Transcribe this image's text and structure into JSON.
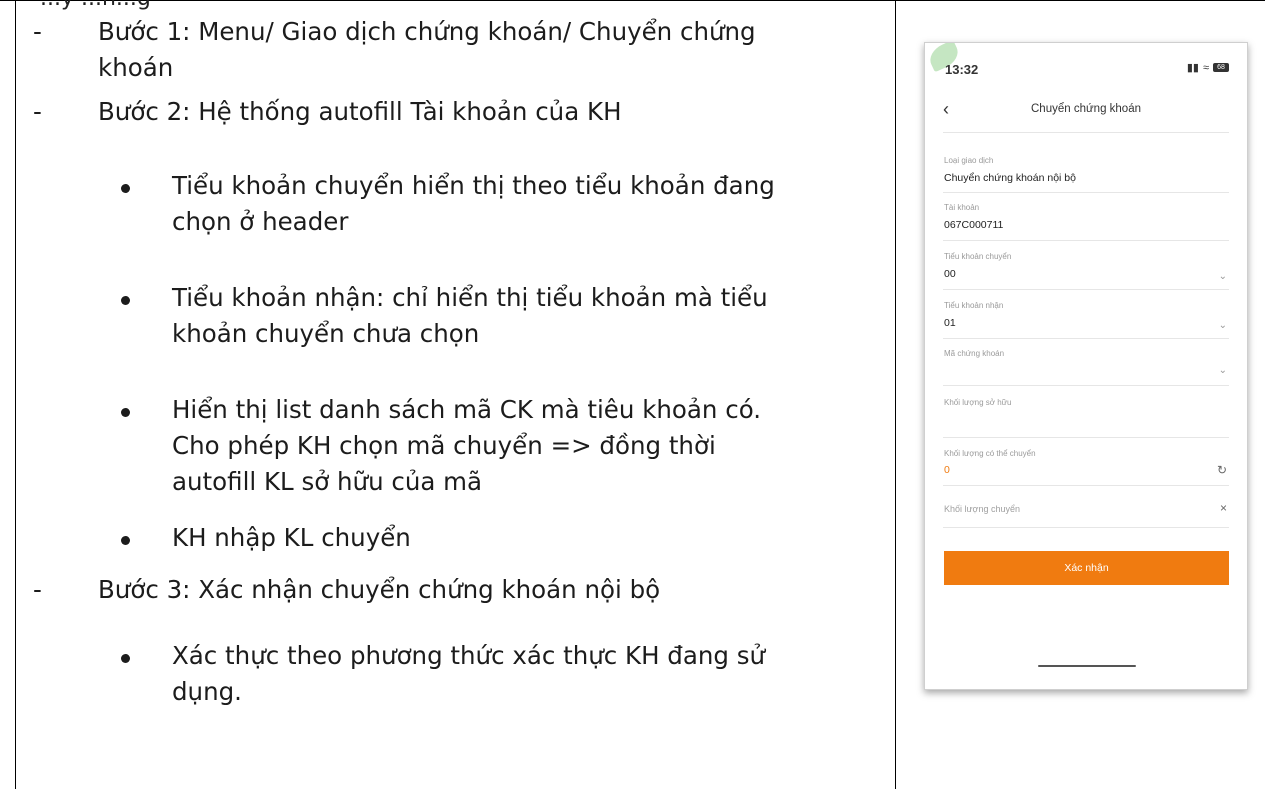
{
  "header_fragment": "...y ...n...g",
  "steps": {
    "dash": "-",
    "step1_line1": "Bước 1: Menu/ Giao dịch chứng khoán/ Chuyển chứng",
    "step1_line2": "khoán",
    "step2": "Bước 2: Hệ thống autofill Tài khoản của KH",
    "bullet1_line1": "Tiểu khoản chuyển hiển thị theo tiểu khoản đang",
    "bullet1_line2": "chọn ở header",
    "bullet2_line1": "Tiểu khoản nhận: chỉ hiển thị tiểu khoản mà tiểu",
    "bullet2_line2": "khoản chuyển chưa chọn",
    "bullet3_line1": "Hiển thị list danh sách mã CK mà tiêu khoản có.",
    "bullet3_line2": "Cho phép KH chọn mã chuyển => đồng thời",
    "bullet3_line3": "autofill KL sở hữu của mã",
    "bullet4": "KH nhập KL chuyển",
    "step3": "Bước 3: Xác nhận chuyển chứng khoán nội bộ",
    "bullet5_line1": "Xác thực theo phương thức xác thực KH đang sử",
    "bullet5_line2": "dụng."
  },
  "phone": {
    "time": "13:32",
    "battery": "68",
    "title": "Chuyển chứng khoán",
    "fields": {
      "transaction_type_label": "Loại giao dịch",
      "transaction_type_value": "Chuyển chứng khoán nội bộ",
      "account_label": "Tài khoản",
      "account_value": "067C000711",
      "from_sub_label": "Tiểu khoản chuyển",
      "from_sub_value": "00",
      "to_sub_label": "Tiểu khoản nhận",
      "to_sub_value": "01",
      "symbol_label": "Mã chứng khoán",
      "owned_qty_label": "Khối lượng sở hữu",
      "available_qty_label": "Khối lượng có thể chuyển",
      "available_qty_value": "0",
      "transfer_qty_placeholder": "Khối lượng chuyển"
    },
    "confirm_button": "Xác nhận",
    "accent_color": "#f07b10"
  }
}
